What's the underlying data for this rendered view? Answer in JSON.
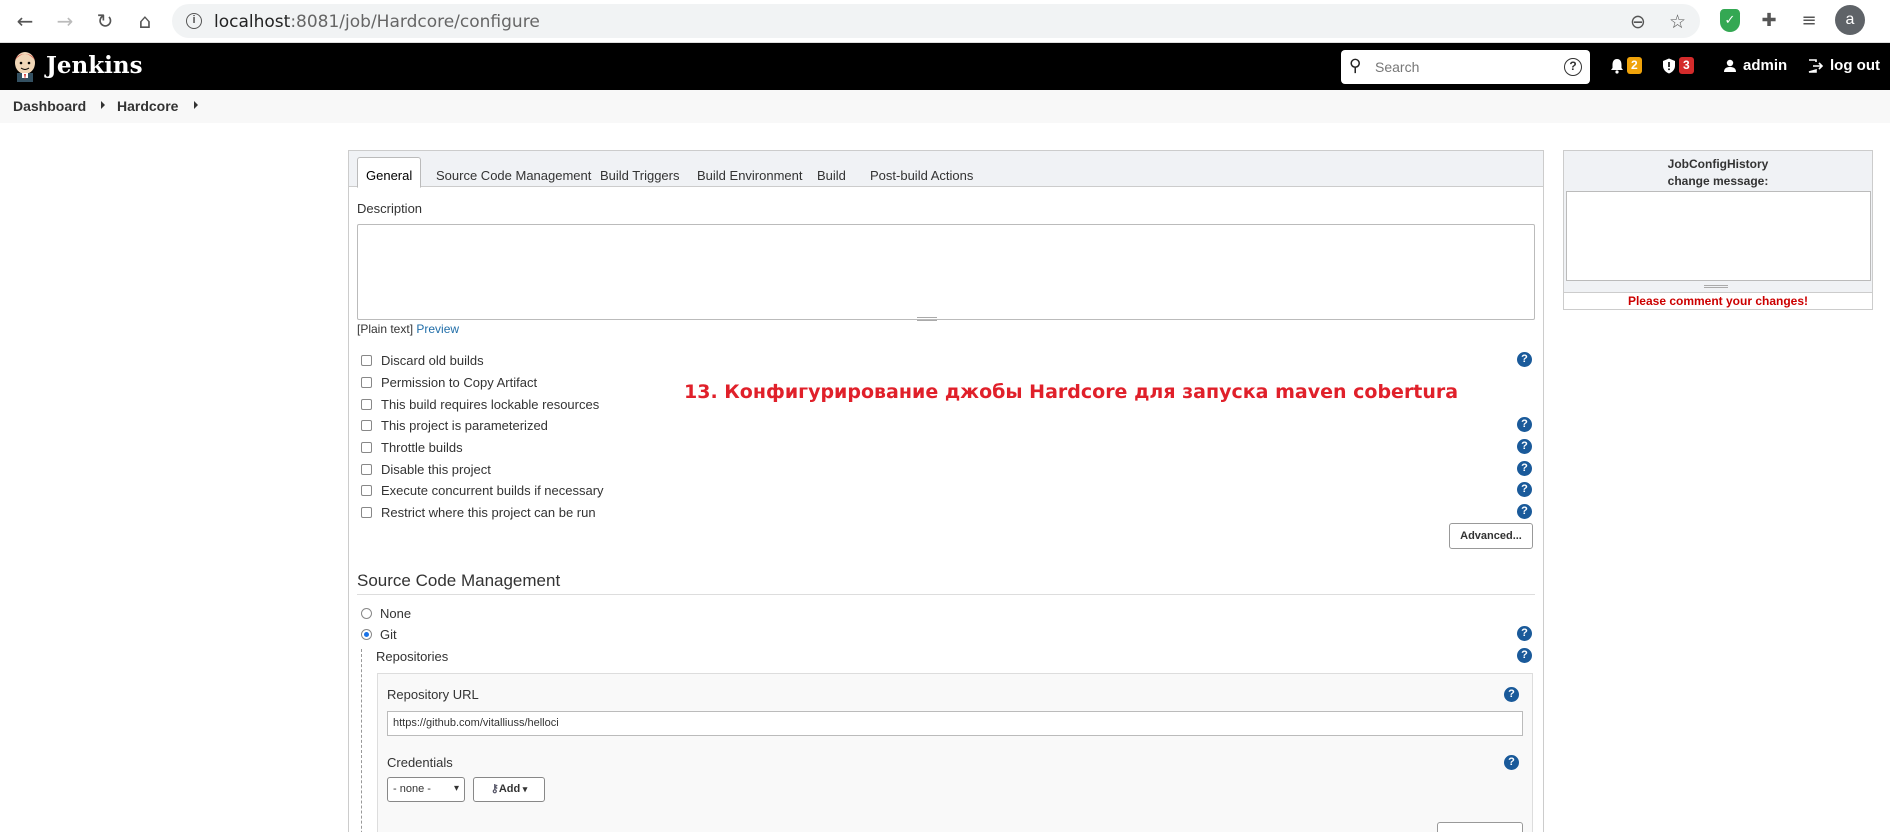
{
  "browser": {
    "url_host": "localhost",
    "url_rest": ":8081/job/Hardcore/configure",
    "avatar_letter": "a"
  },
  "header": {
    "app_title": "Jenkins",
    "search_placeholder": "Search",
    "notifications_count": "2",
    "security_count": "3",
    "user": "admin",
    "logout": "log out",
    "notif_badge_color": "#f0a30a",
    "security_badge_color": "#d42b2b"
  },
  "breadcrumb": {
    "items": [
      "Dashboard",
      "Hardcore"
    ]
  },
  "tabs": [
    "General",
    "Source Code Management",
    "Build Triggers",
    "Build Environment",
    "Build",
    "Post-build Actions"
  ],
  "general": {
    "description_label": "Description",
    "plain_text": "[Plain text]",
    "preview": "Preview",
    "options": [
      "Discard old builds",
      "Permission to Copy Artifact",
      "This build requires lockable resources",
      "This project is parameterized",
      "Throttle builds",
      "Disable this project",
      "Execute concurrent builds if necessary",
      "Restrict where this project can be run"
    ],
    "advanced_button": "Advanced..."
  },
  "annotation": "13. Конфигурирование джобы Hardcore для запуска maven cobertura",
  "scm": {
    "title": "Source Code Management",
    "none_label": "None",
    "git_label": "Git",
    "repositories_label": "Repositories",
    "repo_url_label": "Repository URL",
    "repo_url_value": "https://github.com/vitalliuss/helloci",
    "credentials_label": "Credentials",
    "credentials_selected": "- none -",
    "add_button": "Add"
  },
  "jch": {
    "title_line1": "JobConfigHistory",
    "title_line2": "change message:",
    "warning": "Please comment your changes!"
  }
}
